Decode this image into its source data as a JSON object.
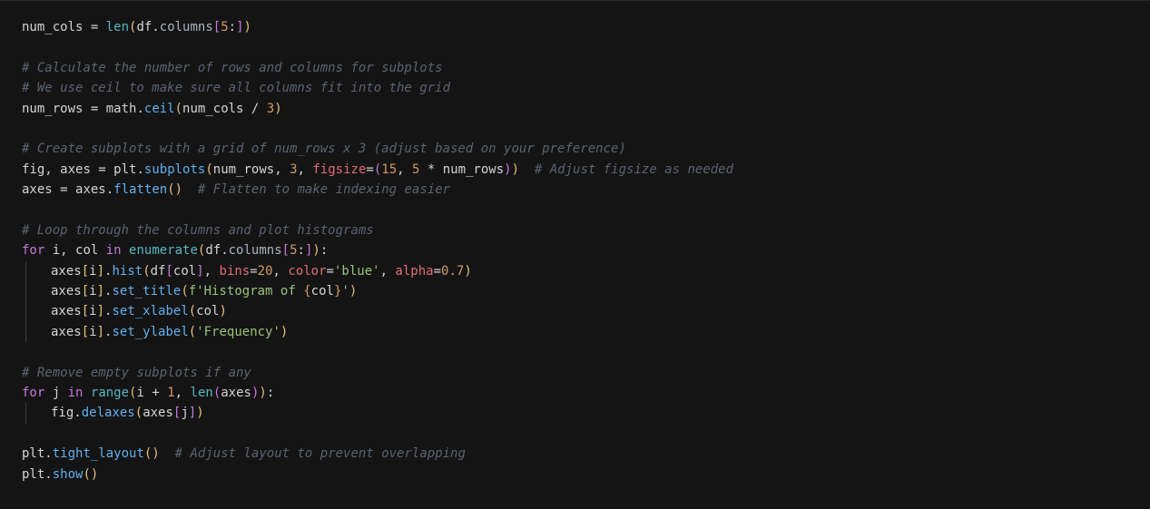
{
  "lines": {
    "l1": {
      "t1": "num_cols",
      "t2": " = ",
      "t3": "len",
      "t4": "(",
      "t5": "df",
      "t6": ".",
      "t7": "columns",
      "t8": "[",
      "t9": "5",
      "t10": ":",
      "t11": "]",
      "t12": ")"
    },
    "l2": "",
    "l3": "# Calculate the number of rows and columns for subplots",
    "l4": "# We use ceil to make sure all columns fit into the grid",
    "l5": {
      "t1": "num_rows",
      "t2": " = ",
      "t3": "math",
      "t4": ".",
      "t5": "ceil",
      "t6": "(",
      "t7": "num_cols",
      "t8": " / ",
      "t9": "3",
      "t10": ")"
    },
    "l6": "",
    "l7": "# Create subplots with a grid of num_rows x 3 (adjust based on your preference)",
    "l8": {
      "t1": "fig",
      "t2": ", ",
      "t3": "axes",
      "t4": " = ",
      "t5": "plt",
      "t6": ".",
      "t7": "subplots",
      "t8": "(",
      "t9": "num_rows",
      "t10": ", ",
      "t11": "3",
      "t12": ", ",
      "t13": "figsize",
      "t14": "=",
      "t15": "(",
      "t16": "15",
      "t17": ", ",
      "t18": "5",
      "t19": " * ",
      "t20": "num_rows",
      "t21": ")",
      "t22": ")",
      "t23": "  # Adjust figsize as needed"
    },
    "l9": {
      "t1": "axes",
      "t2": " = ",
      "t3": "axes",
      "t4": ".",
      "t5": "flatten",
      "t6": "(",
      "t7": ")",
      "t8": "  # Flatten to make indexing easier"
    },
    "l10": "",
    "l11": "# Loop through the columns and plot histograms",
    "l12": {
      "t1": "for",
      "t2": " i",
      "t3": ", ",
      "t4": "col ",
      "t5": "in",
      "t6": " ",
      "t7": "enumerate",
      "t8": "(",
      "t9": "df",
      "t10": ".",
      "t11": "columns",
      "t12": "[",
      "t13": "5",
      "t14": ":",
      "t15": "]",
      "t16": ")",
      "t17": ":"
    },
    "l13": {
      "t1": "axes",
      "t2": "[",
      "t3": "i",
      "t4": "]",
      "t5": ".",
      "t6": "hist",
      "t7": "(",
      "t8": "df",
      "t9": "[",
      "t10": "col",
      "t11": "]",
      "t12": ", ",
      "t13": "bins",
      "t14": "=",
      "t15": "20",
      "t16": ", ",
      "t17": "color",
      "t18": "=",
      "t19": "'blue'",
      "t20": ", ",
      "t21": "alpha",
      "t22": "=",
      "t23": "0.7",
      "t24": ")"
    },
    "l14": {
      "t1": "axes",
      "t2": "[",
      "t3": "i",
      "t4": "]",
      "t5": ".",
      "t6": "set_title",
      "t7": "(",
      "t8": "f'Histogram of ",
      "t9": "{",
      "t10": "col",
      "t11": "}",
      "t12": "'",
      "t13": ")"
    },
    "l15": {
      "t1": "axes",
      "t2": "[",
      "t3": "i",
      "t4": "]",
      "t5": ".",
      "t6": "set_xlabel",
      "t7": "(",
      "t8": "col",
      "t9": ")"
    },
    "l16": {
      "t1": "axes",
      "t2": "[",
      "t3": "i",
      "t4": "]",
      "t5": ".",
      "t6": "set_ylabel",
      "t7": "(",
      "t8": "'Frequency'",
      "t9": ")"
    },
    "l17": "",
    "l18": "# Remove empty subplots if any",
    "l19": {
      "t1": "for",
      "t2": " j ",
      "t3": "in",
      "t4": " ",
      "t5": "range",
      "t6": "(",
      "t7": "i",
      "t8": " + ",
      "t9": "1",
      "t10": ", ",
      "t11": "len",
      "t12": "(",
      "t13": "axes",
      "t14": ")",
      "t15": ")",
      "t16": ":"
    },
    "l20": {
      "t1": "fig",
      "t2": ".",
      "t3": "delaxes",
      "t4": "(",
      "t5": "axes",
      "t6": "[",
      "t7": "j",
      "t8": "]",
      "t9": ")"
    },
    "l21": "",
    "l22": {
      "t1": "plt",
      "t2": ".",
      "t3": "tight_layout",
      "t4": "(",
      "t5": ")",
      "t6": "  # Adjust layout to prevent overlapping"
    },
    "l23": {
      "t1": "plt",
      "t2": ".",
      "t3": "show",
      "t4": "(",
      "t5": ")"
    }
  }
}
